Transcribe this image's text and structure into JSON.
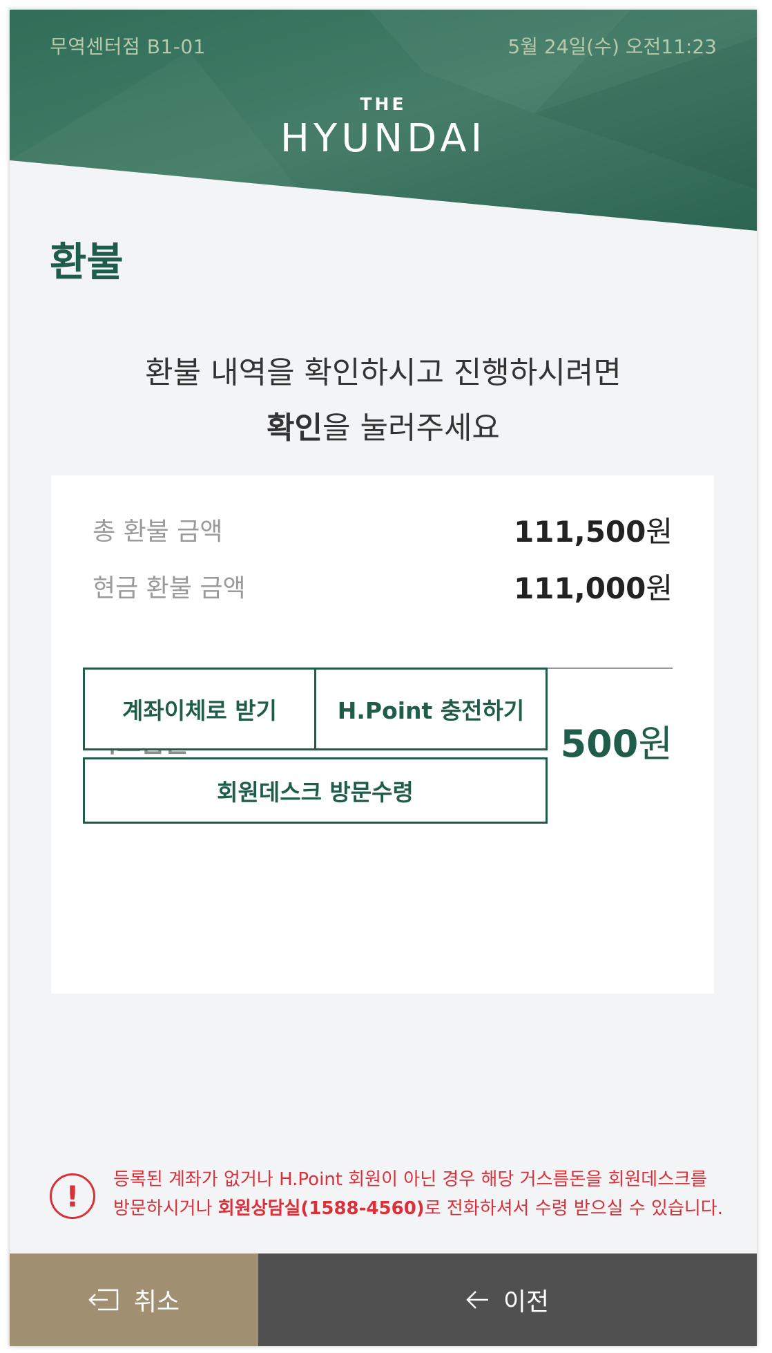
{
  "header": {
    "store": "무역센터점 B1-01",
    "datetime": "5월 24일(수) 오전11:23",
    "logo_the": "THE",
    "logo_main": "HYUNDAI"
  },
  "page": {
    "title": "환불",
    "guide_line1": "환불 내역을 확인하시고 진행하시려면",
    "guide_line2_strong": "확인",
    "guide_line2_rest": "을 눌러주세요"
  },
  "summary": {
    "total_label": "총 환불 금액",
    "total_amount": "111,500",
    "cash_label": "현금 환불 금액",
    "cash_amount": "111,000",
    "change_label": "거스름돈",
    "change_amount": "500",
    "unit": "원"
  },
  "options": {
    "bank_transfer": "계좌이체로 받기",
    "hpoint_charge": "H.Point 충전하기",
    "desk_visit": "회원데스크 방문수령"
  },
  "notice": {
    "text_part1": "등록된 계좌가 없거나 H.Point 회원이 아닌 경우 해당 거스름돈을 회원데스크를",
    "text_part2": "방문하시거나 ",
    "text_strong": "회원상담실(1588-4560)",
    "text_part3": "로 전화하셔서 수령 받으실 수 있습니다.",
    "icon": "exclamation-icon"
  },
  "footer": {
    "cancel_label": "취소",
    "prev_label": "이전",
    "cancel_icon": "exit-icon",
    "prev_icon": "arrow-left-icon"
  },
  "colors": {
    "brand_green": "#1f5c4a",
    "header_green": "#3f7a63",
    "alert_red": "#d9303a",
    "cancel_bg": "#a18f72",
    "prev_bg": "#505050"
  }
}
